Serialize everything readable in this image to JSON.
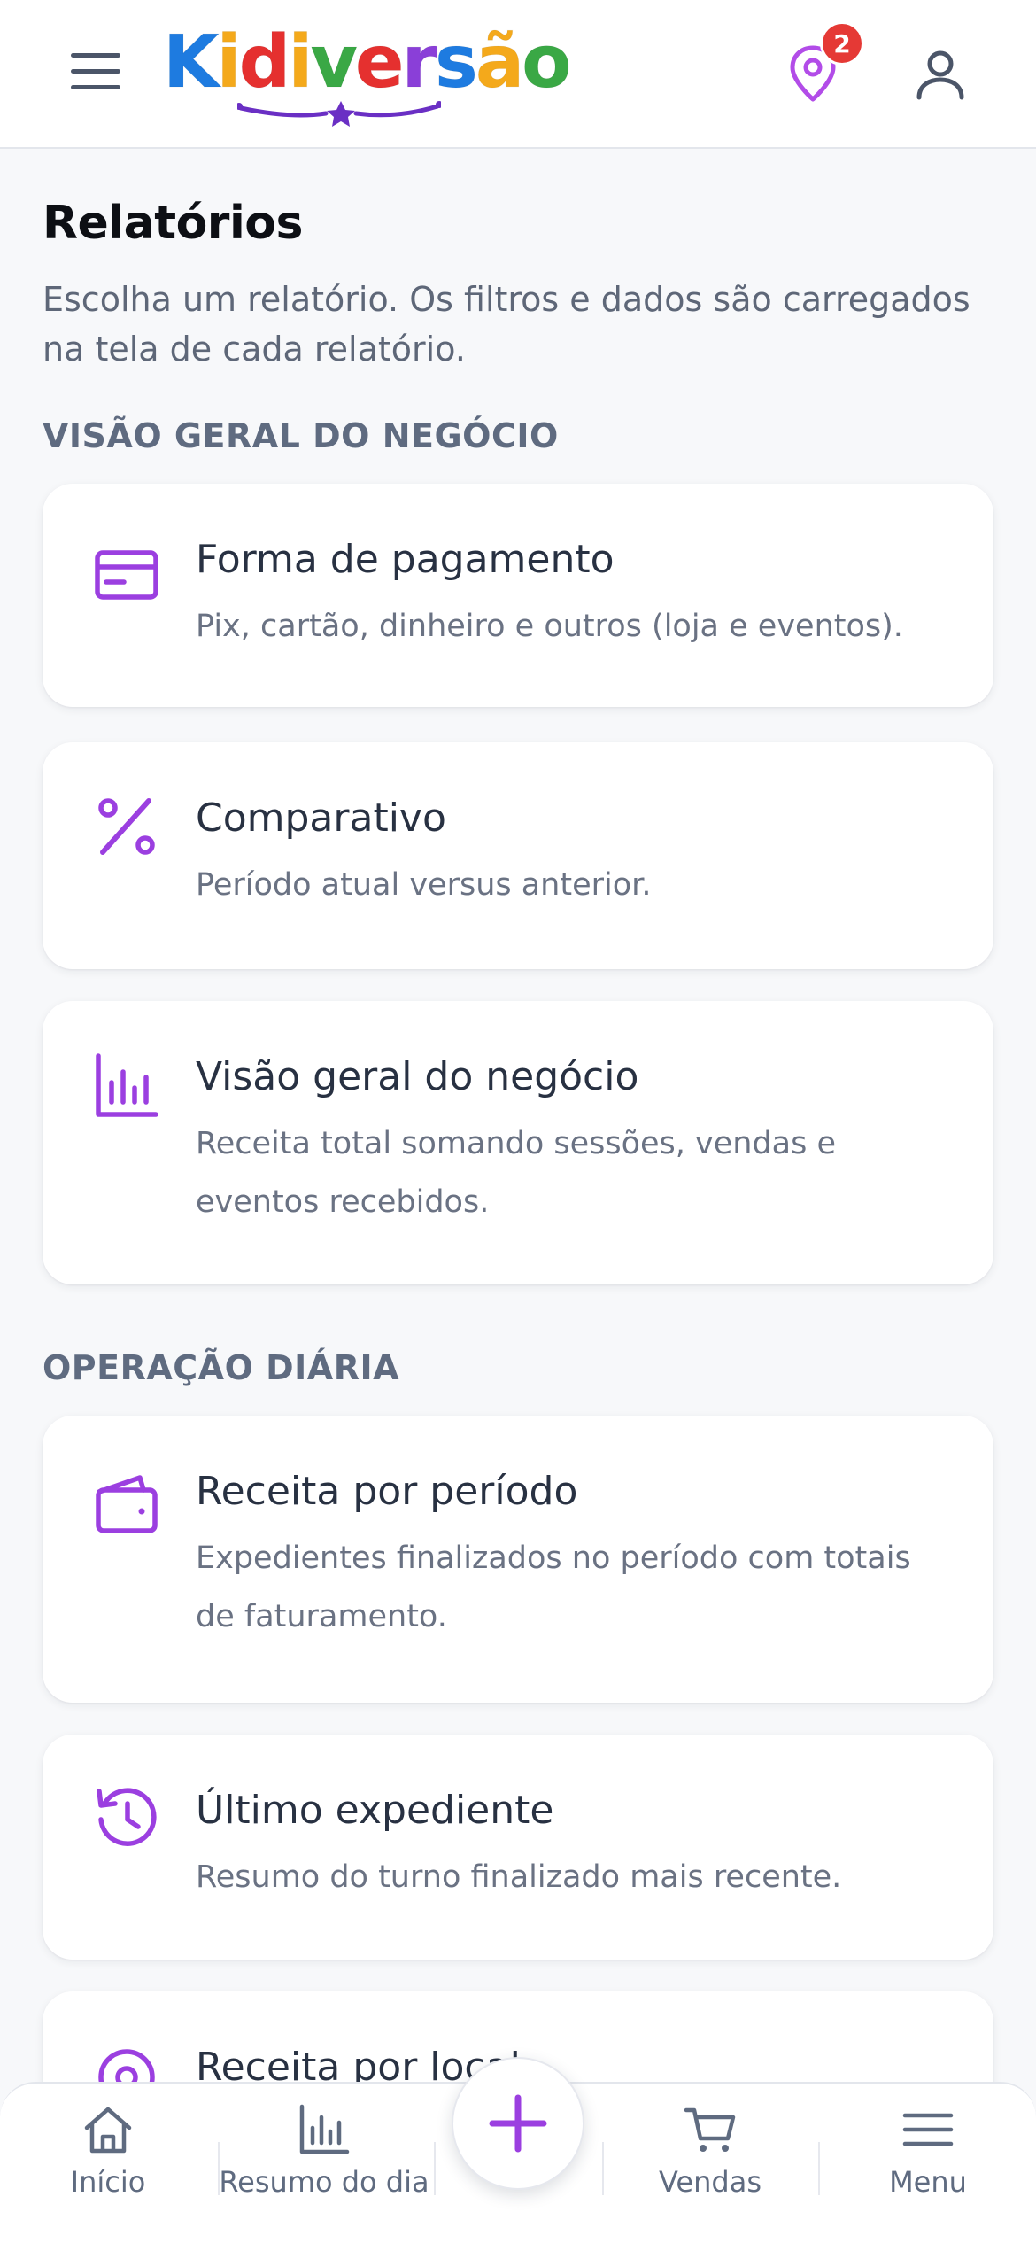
{
  "header": {
    "logo": {
      "letters": [
        "K",
        "i",
        "d",
        "i",
        "v",
        "e",
        "r",
        "s",
        "ã",
        "o"
      ]
    },
    "notification_count": "2"
  },
  "page": {
    "title": "Relatórios",
    "subtitle": "Escolha um relatório. Os filtros e dados são carregados na tela de cada relatório."
  },
  "sections": [
    {
      "label": "VISÃO GERAL DO NEGÓCIO",
      "cards": [
        {
          "icon": "credit-card-icon",
          "title": "Forma de pagamento",
          "description": "Pix, cartão, dinheiro e outros (loja e eventos)."
        },
        {
          "icon": "percent-icon",
          "title": "Comparativo",
          "description": "Período atual versus anterior."
        },
        {
          "icon": "bar-chart-icon",
          "title": "Visão geral do negócio",
          "description": "Receita total somando sessões, vendas e eventos recebidos."
        }
      ]
    },
    {
      "label": "OPERAÇÃO DIÁRIA",
      "cards": [
        {
          "icon": "wallet-icon",
          "title": "Receita por período",
          "description": "Expedientes finalizados no período com totais de faturamento."
        },
        {
          "icon": "history-icon",
          "title": "Último expediente",
          "description": "Resumo do turno finalizado mais recente."
        },
        {
          "icon": "location-icon",
          "title": "Receita por local",
          "description": ""
        }
      ]
    }
  ],
  "bottom_nav": {
    "items": [
      {
        "icon": "home-icon",
        "label": "Início"
      },
      {
        "icon": "bar-chart-icon",
        "label": "Resumo do dia"
      },
      {
        "icon": "cart-icon",
        "label": "Vendas"
      },
      {
        "icon": "menu-icon",
        "label": "Menu"
      }
    ]
  },
  "colors": {
    "accent": "#9b3fe0",
    "badge": "#e53935",
    "text_dark": "#283142",
    "text_muted": "#6a7283",
    "section_label": "#5f6b80",
    "logo_letters": [
      "#1e7be0",
      "#f4a91b",
      "#e5302f",
      "#f4a91b",
      "#3aa845",
      "#e5302f",
      "#8a3fd8",
      "#1e7be0",
      "#f4a91b",
      "#3aa845"
    ]
  }
}
